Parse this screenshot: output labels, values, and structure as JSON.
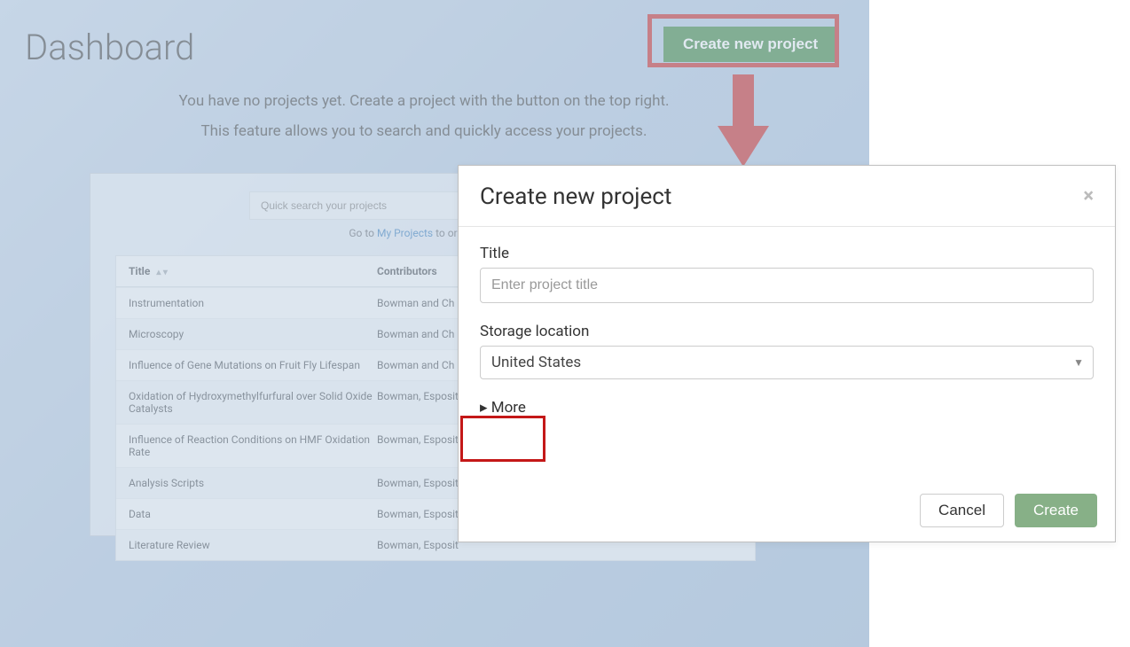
{
  "page": {
    "title": "Dashboard",
    "intro_line1": "You have no projects yet. Create a project with the button on the top right.",
    "intro_line2": "This feature allows you to search and quickly access your projects."
  },
  "header": {
    "create_button_label": "Create new project"
  },
  "projects_panel": {
    "search_placeholder": "Quick search your projects",
    "goto_prefix": "Go to ",
    "goto_link_text": "My Projects",
    "goto_suffix": " to organize your w",
    "columns": {
      "title": "Title",
      "contributors": "Contributors"
    },
    "rows": [
      {
        "title": "Instrumentation",
        "contributors": "Bowman and Ch"
      },
      {
        "title": "Microscopy",
        "contributors": "Bowman and Ch"
      },
      {
        "title": "Influence of Gene Mutations on Fruit Fly Lifespan",
        "contributors": "Bowman and Ch"
      },
      {
        "title": "Oxidation of Hydroxymethylfurfural over Solid Oxide Catalysts",
        "contributors": "Bowman, Esposit"
      },
      {
        "title": "Influence of Reaction Conditions on HMF Oxidation Rate",
        "contributors": "Bowman, Esposit"
      },
      {
        "title": "Analysis Scripts",
        "contributors": "Bowman, Esposit"
      },
      {
        "title": "Data",
        "contributors": "Bowman, Esposit"
      },
      {
        "title": "Literature Review",
        "contributors": "Bowman, Esposit"
      }
    ]
  },
  "modal": {
    "title": "Create new project",
    "title_field_label": "Title",
    "title_field_placeholder": "Enter project title",
    "storage_label": "Storage location",
    "storage_value": "United States",
    "more_label": "More",
    "cancel_label": "Cancel",
    "create_label": "Create"
  },
  "annotations": {
    "arrow_color": "#c41818",
    "highlight_color": "#c41818"
  }
}
